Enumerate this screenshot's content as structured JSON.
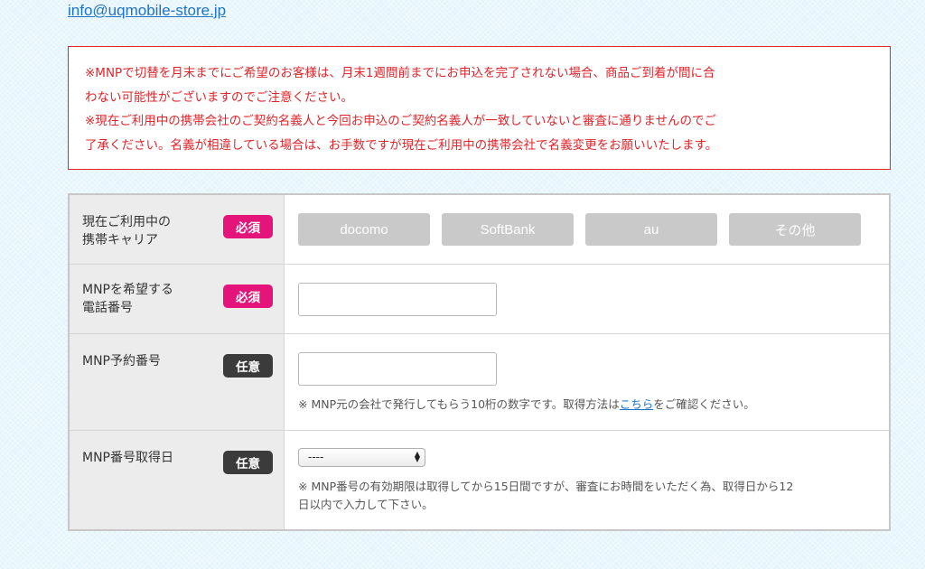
{
  "contact": {
    "email": "info@uqmobile-store.jp"
  },
  "notice": {
    "lines": [
      "※MNPで切替を月末までにご希望のお客様は、月末1週間前までにお申込を完了されない場合、商品ご到着が間に合",
      "わない可能性がございますのでご注意ください。",
      "※現在ご利用中の携帯会社のご契約名義人と今回お申込のご契約名義人が一致していないと審査に通りませんのでご",
      "了承ください。名義が相違している場合は、お手数ですが現在ご利用中の携帯会社で名義変更をお願いいたします。"
    ]
  },
  "form": {
    "carrier": {
      "label_line1": "現在ご利用中の",
      "label_line2": "携帯キャリア",
      "badge": "必須",
      "options": [
        "docomo",
        "SoftBank",
        "au",
        "その他"
      ]
    },
    "phone": {
      "label_line1": "MNPを希望する",
      "label_line2": "電話番号",
      "badge": "必須",
      "value": ""
    },
    "reservation": {
      "label": "MNP予約番号",
      "badge": "任意",
      "value": "",
      "hint_before": "※ MNP元の会社で発行してもらう10桁の数字です。取得方法は",
      "hint_link": "こちら",
      "hint_after": "をご確認ください。"
    },
    "date": {
      "label": "MNP番号取得日",
      "badge": "任意",
      "selected": "----",
      "hint_line1": "※ MNP番号の有効期限は取得してから15日間ですが、審査にお時間をいただく為、取得日から12",
      "hint_line2": "日以内で入力して下さい。"
    }
  }
}
